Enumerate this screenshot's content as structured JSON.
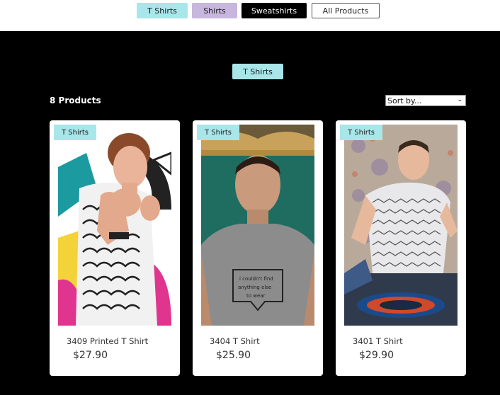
{
  "filters": {
    "tshirts": "T Shirts",
    "shirts": "Shirts",
    "sweatshirts": "Sweatshirts",
    "all": "All Products"
  },
  "category_badge": "T Shirts",
  "product_count": "8 Products",
  "sort": {
    "value": "Sort by..."
  },
  "products": [
    {
      "tag": "T Shirts",
      "name": "3409 Printed T Shirt",
      "price": "$27.90"
    },
    {
      "tag": "T Shirts",
      "name": "3404 T Shirt",
      "price": "$25.90"
    },
    {
      "tag": "T Shirts",
      "name": "3401 T Shirt",
      "price": "$29.90"
    }
  ],
  "colors": {
    "accent_teal": "#a8e6ea",
    "accent_lavender": "#c7b6dd",
    "page_bg": "#000000"
  }
}
